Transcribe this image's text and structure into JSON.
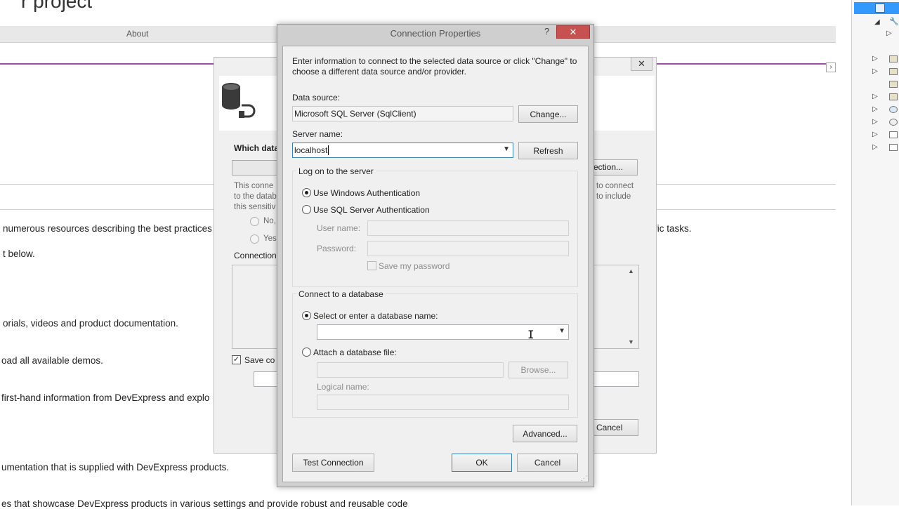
{
  "background_page": {
    "title": "r project",
    "nav_about": "About",
    "lines": [
      "numerous resources describing the best practices",
      "t below.",
      "orials, videos and product documentation.",
      "oad all available demos.",
      "first-hand information from DevExpress and explo",
      "umentation that is supplied with DevExpress products.",
      "es that showcase DevExpress products in various settings and provide robust and reusable code"
    ],
    "right_text": "fic tasks."
  },
  "wizard": {
    "question": "Which data",
    "new_connection_button": "ection...",
    "info_left": [
      "This conne",
      "to the datab",
      "this sensitiv"
    ],
    "info_right": [
      "to connect",
      "to include"
    ],
    "radio_no": "No,",
    "radio_yes": "Yes",
    "connection_label": "Connection",
    "save_label": "Save co",
    "cancel_button": "Cancel",
    "close_glyph": "✕"
  },
  "dialog": {
    "title": "Connection Properties",
    "help_glyph": "?",
    "close_glyph": "✕",
    "intro": "Enter information to connect to the selected data source or click \"Change\" to choose a different data source and/or provider.",
    "data_source_label": "Data source:",
    "data_source_value": "Microsoft SQL Server (SqlClient)",
    "change_button": "Change...",
    "server_name_label": "Server name:",
    "server_name_value": "localhost",
    "refresh_button": "Refresh",
    "logon_group": "Log on to the server",
    "windows_auth": "Use Windows Authentication",
    "sql_auth": "Use SQL Server Authentication",
    "user_name_label": "User name:",
    "password_label": "Password:",
    "save_password": "Save my password",
    "connect_group": "Connect to a database",
    "select_db": "Select or enter a database name:",
    "attach_file": "Attach a database file:",
    "browse_button": "Browse...",
    "logical_name_label": "Logical name:",
    "advanced_button": "Advanced...",
    "test_button": "Test Connection",
    "ok_button": "OK",
    "cancel_button": "Cancel"
  },
  "colors": {
    "accent_purple": "#9a4fa6",
    "close_red": "#c75050",
    "selection_blue": "#3399ff"
  }
}
